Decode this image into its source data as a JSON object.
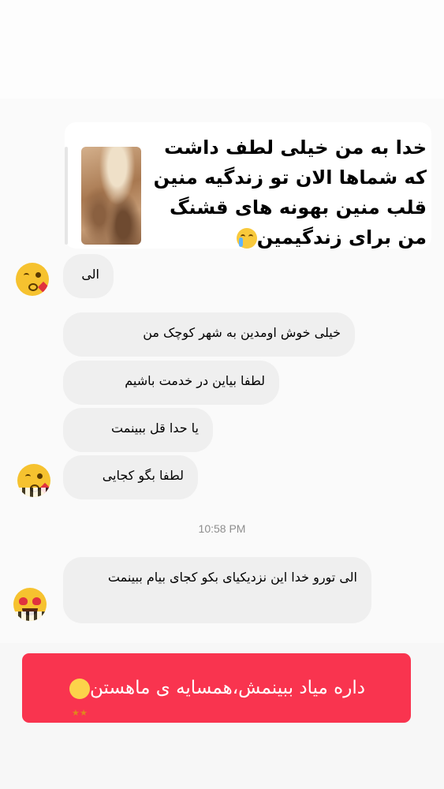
{
  "story_reply": {
    "caption_lines": [
      "خدا به من خیلی لطف داشت",
      "که شماها الان تو زندگیه منین",
      "قلب منین بهونه های قشنگ",
      "من برای زندگیمین"
    ],
    "caption_emoji": "loudly-crying-face"
  },
  "messages": [
    {
      "text": "الی"
    },
    {
      "text": "خیلی خوش اومدین به شهر کوچک من"
    },
    {
      "text": "لطفا بیاین در خدمت باشیم"
    },
    {
      "text": "یا حدا قل ببینمت"
    },
    {
      "text": "لطفا بگو کجایی"
    },
    {
      "text": "الی تورو خدا این نزدیکیای بکو کجای بیام ببینمت"
    }
  ],
  "avatars": [
    "face-blowing-kiss",
    "face-blowing-kiss",
    "heart-eyes"
  ],
  "timestamp": "10:58 PM",
  "banner": {
    "text": "داره میاد ببینمش،همسایه ی ماهستن",
    "emoji": "star-struck",
    "color": "#f9344f"
  }
}
